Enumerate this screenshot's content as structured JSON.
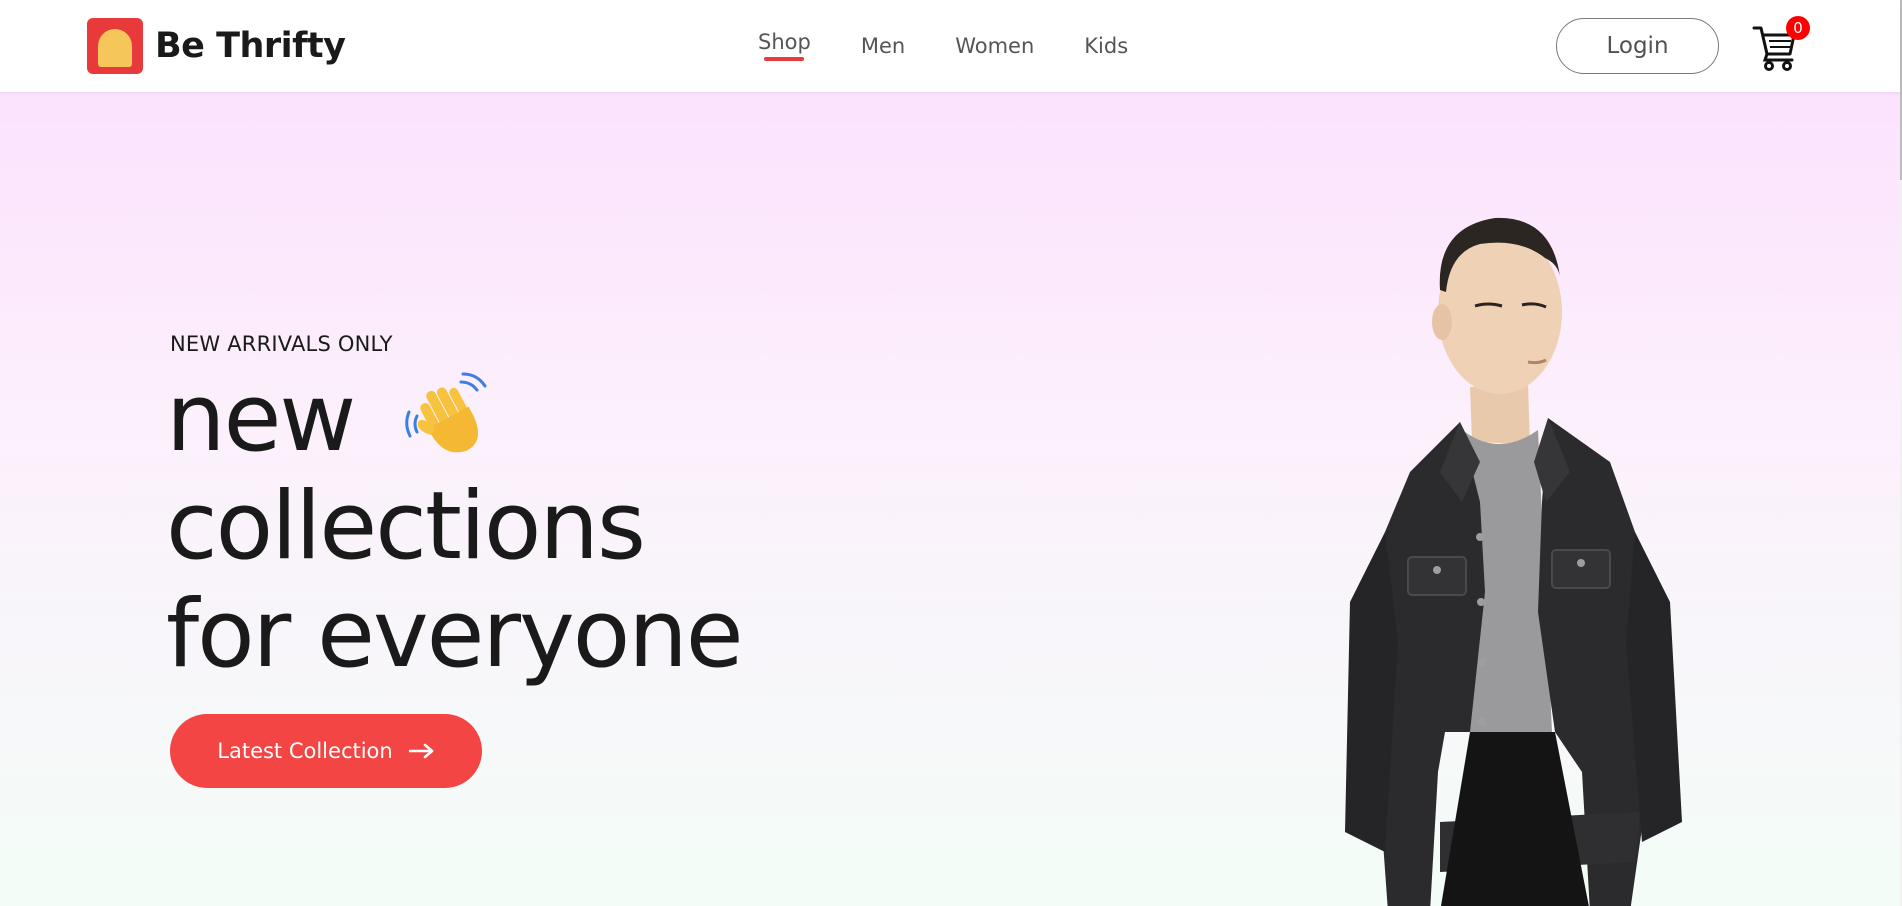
{
  "brand": {
    "name": "Be Thrifty",
    "logo_icon": "logo-icon",
    "accent_color": "#e83a3a",
    "logo_fill_color": "#f5c75b"
  },
  "nav": {
    "items": [
      {
        "label": "Shop",
        "active": true
      },
      {
        "label": "Men",
        "active": false
      },
      {
        "label": "Women",
        "active": false
      },
      {
        "label": "Kids",
        "active": false
      }
    ],
    "active_indicator_color": "#e83a3a"
  },
  "header": {
    "login_label": "Login",
    "cart": {
      "icon": "cart-icon",
      "count": "0",
      "badge_color": "#ff0000"
    }
  },
  "hero": {
    "eyebrow": "NEW ARRIVALS ONLY",
    "headline_lines": [
      "new",
      "collections",
      "for everyone"
    ],
    "headline_icon": "waving-hand-icon",
    "cta_label": "Latest Collection",
    "cta_icon": "arrow-right-icon",
    "cta_color": "#f44545",
    "background_top": "#fbe2fd",
    "background_bottom": "#f3fdf7",
    "image": "model-in-denim-jacket"
  }
}
